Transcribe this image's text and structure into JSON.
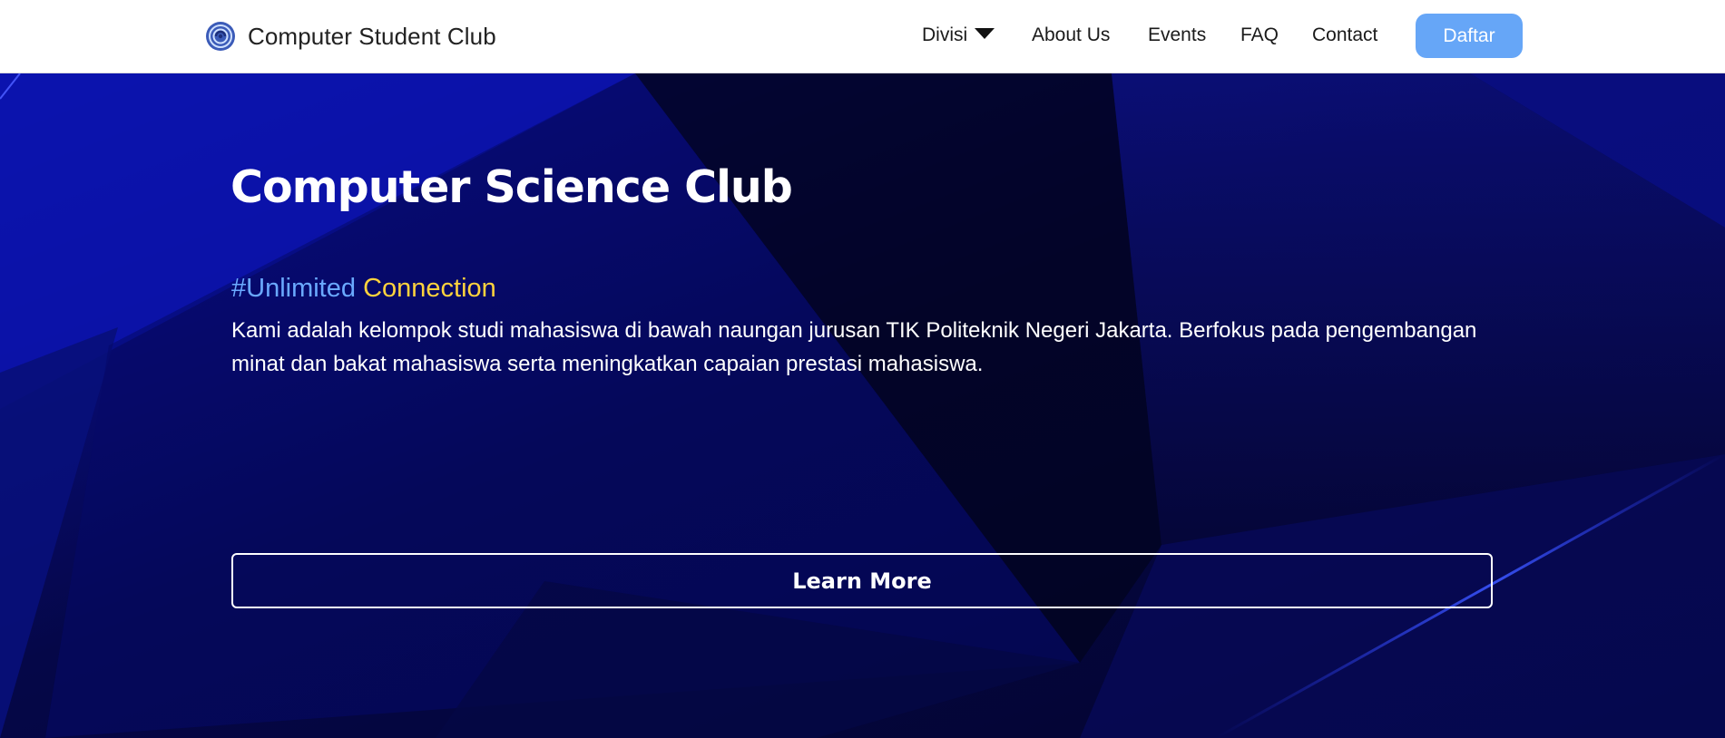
{
  "navbar": {
    "brand_name": "Computer Student Club",
    "logo_icon": "club-logo-icon",
    "items": [
      {
        "label": "Divisi",
        "has_dropdown": true,
        "icon": "caret-down-icon"
      },
      {
        "label": "About Us"
      },
      {
        "label": "Events"
      },
      {
        "label": "FAQ"
      },
      {
        "label": "Contact"
      }
    ],
    "cta_label": "Daftar"
  },
  "hero": {
    "title": "Computer Science Club",
    "tagline_part1": "#Unlimited",
    "tagline_part2": "Connection",
    "description": "Kami adalah kelompok studi mahasiswa di bawah naungan jurusan TIK Politeknik Negeri Jakarta. Berfokus pada pengembangan minat dan bakat mahasiswa serta meningkatkan capaian prestasi mahasiswa.",
    "button_label": "Learn More"
  },
  "colors": {
    "navbar_bg": "#ffffff",
    "cta_bg": "#66a6f7",
    "hero_bg": "#06084d",
    "tagline_blue": "#6aa9ff",
    "tagline_yellow": "#ffd33d",
    "text_white": "#ffffff"
  }
}
